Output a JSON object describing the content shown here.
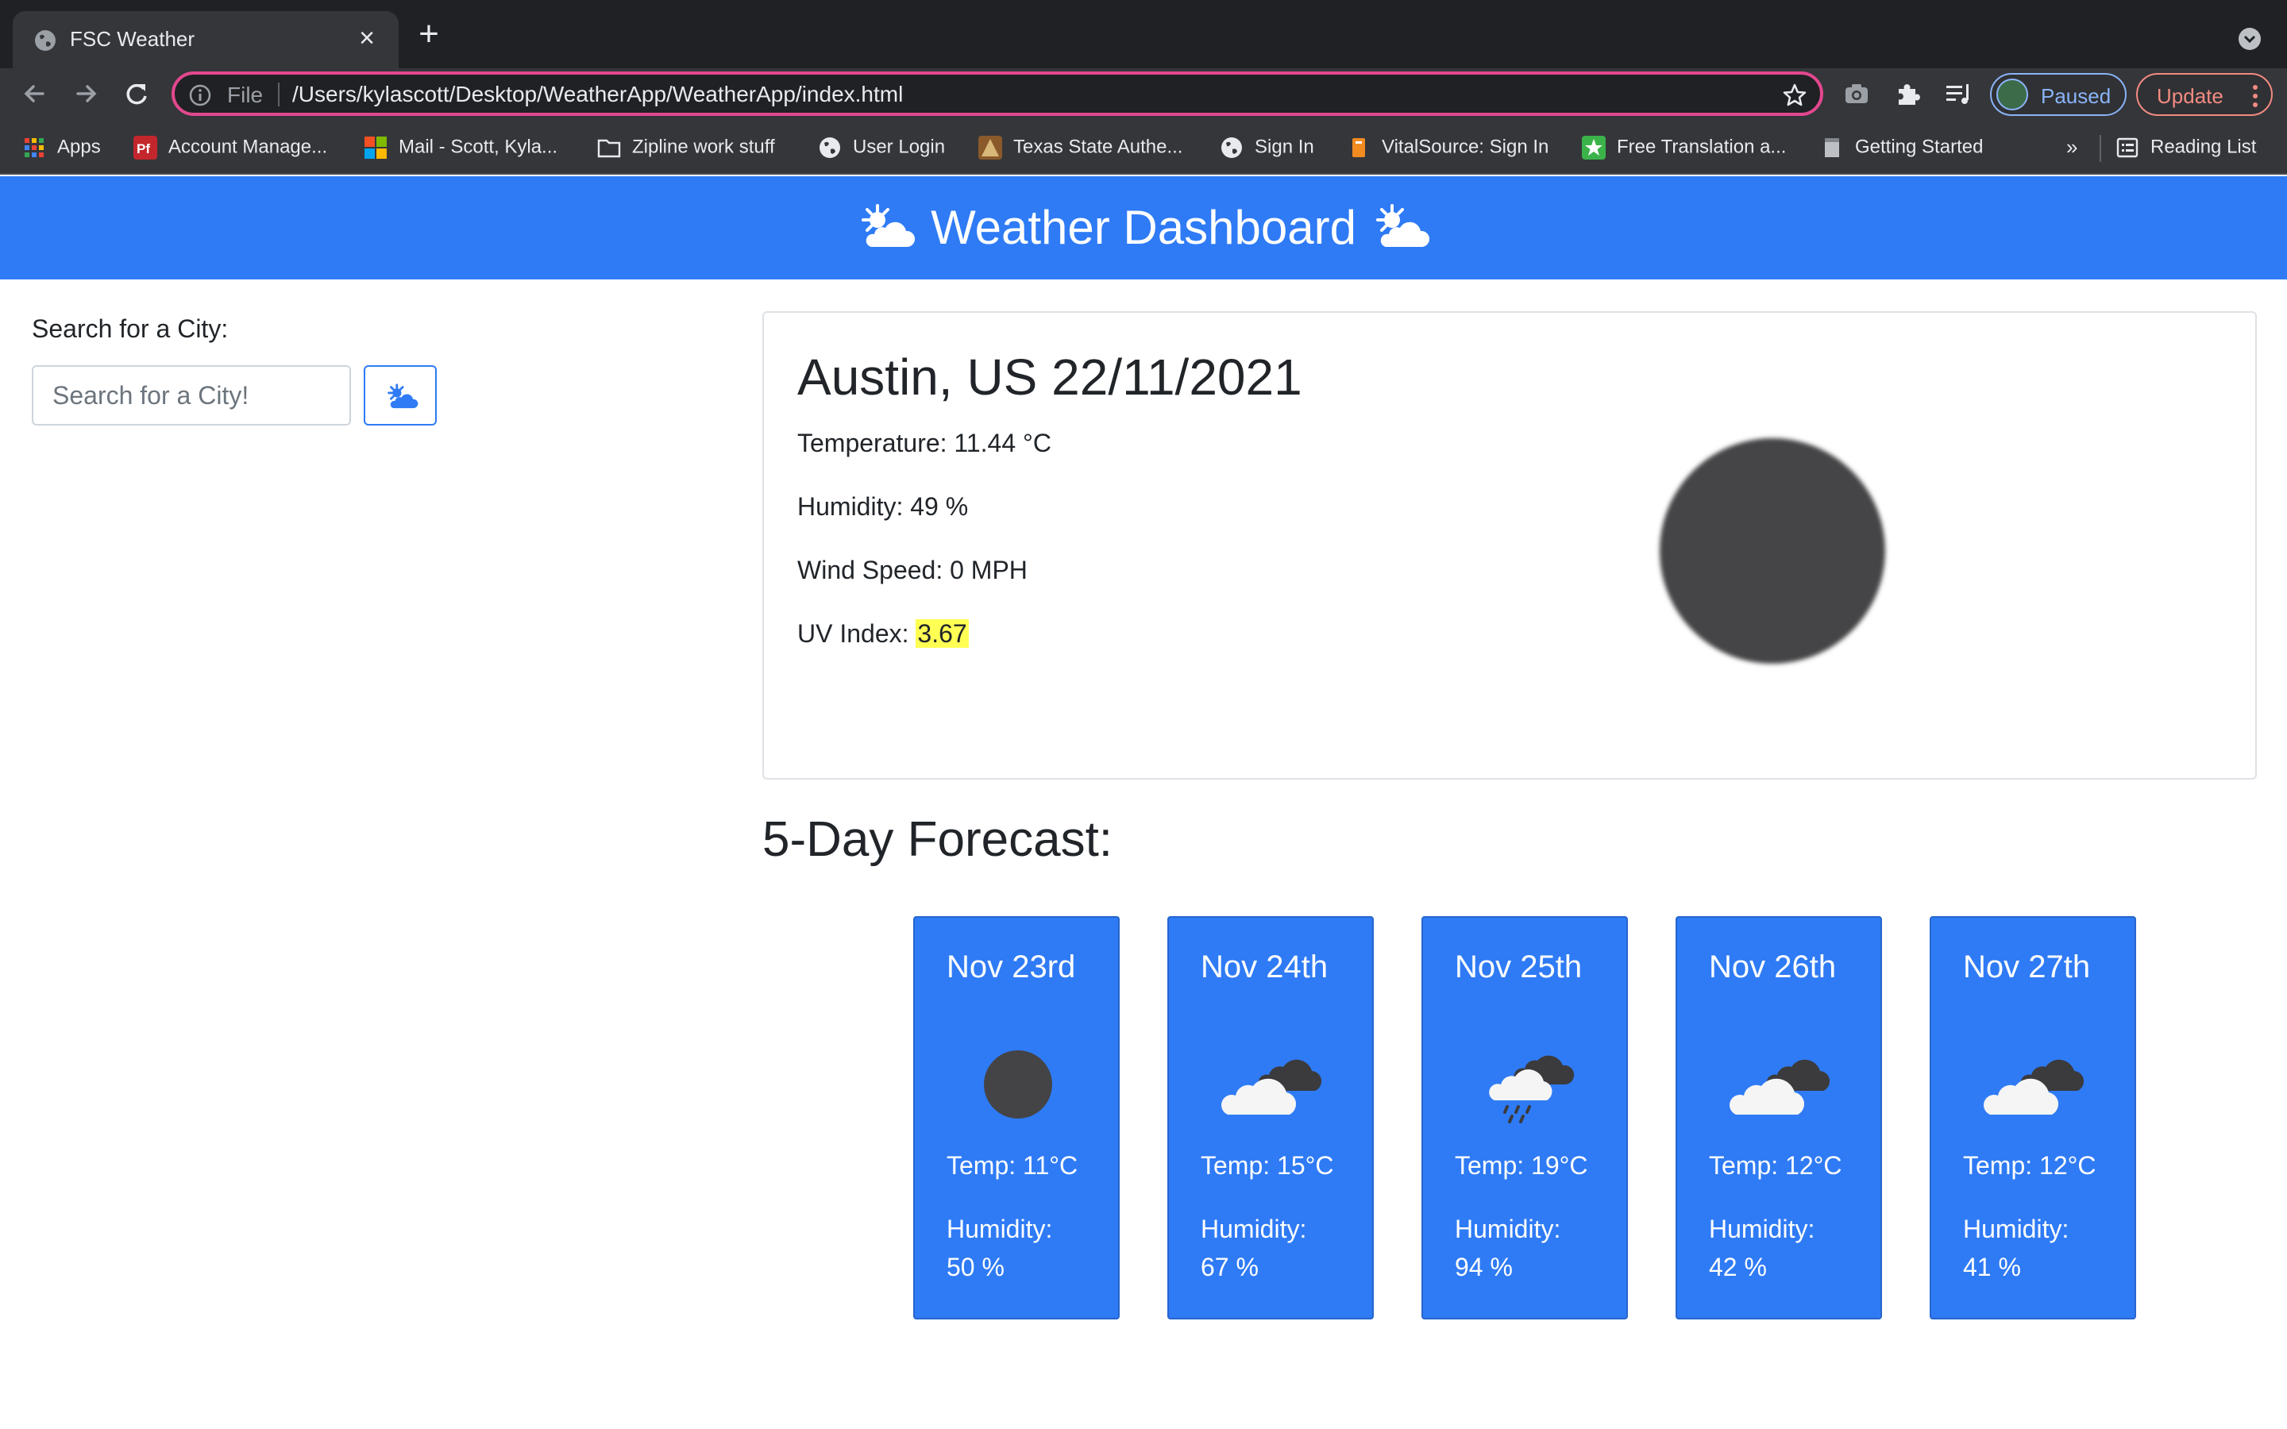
{
  "browser": {
    "tab_title": "FSC Weather",
    "address_scheme": "File",
    "address_url": "/Users/kylascott/Desktop/WeatherApp/WeatherApp/index.html",
    "profile_label": "Paused",
    "update_label": "Update",
    "bookmarks": [
      {
        "label": "Apps",
        "icon": "apps-grid-icon"
      },
      {
        "label": "Account Manage...",
        "icon": "pf-icon"
      },
      {
        "label": "Mail - Scott, Kyla...",
        "icon": "microsoft-icon"
      },
      {
        "label": "Zipline work stuff",
        "icon": "folder-icon"
      },
      {
        "label": "User Login",
        "icon": "globe-icon"
      },
      {
        "label": "Texas State Authe...",
        "icon": "texas-state-icon"
      },
      {
        "label": "Sign In",
        "icon": "globe-icon"
      },
      {
        "label": "VitalSource: Sign In",
        "icon": "vitalsource-icon"
      },
      {
        "label": "Free Translation a...",
        "icon": "translation-icon"
      },
      {
        "label": "Getting Started",
        "icon": "page-icon"
      }
    ],
    "more_bookmarks": "»",
    "reading_list": "Reading List"
  },
  "header": {
    "title": "Weather Dashboard",
    "icon": "sun-behind-cloud-icon",
    "color": "#2f7bf5"
  },
  "search": {
    "label": "Search for a City:",
    "placeholder": "Search for a City!",
    "button_icon": "sun-behind-cloud-icon"
  },
  "current": {
    "heading": "Austin, US 22/11/2021",
    "temperature": "Temperature: 11.44 °C",
    "humidity": "Humidity: 49 %",
    "wind": "Wind Speed: 0 MPH",
    "uv_label": "UV Index: ",
    "uv_value": "3.67",
    "uv_color": "#ffff54",
    "icon": "dark-moon-icon"
  },
  "forecast": {
    "heading": "5-Day Forecast:",
    "days": [
      {
        "date": "Nov 23rd",
        "icon": "dark-moon-icon",
        "temp": "Temp: 11°C",
        "humidity_label": "Humidity:",
        "humidity": "50 %"
      },
      {
        "date": "Nov 24th",
        "icon": "clouds-icon",
        "temp": "Temp: 15°C",
        "humidity_label": "Humidity:",
        "humidity": "67 %"
      },
      {
        "date": "Nov 25th",
        "icon": "rain-cloud-icon",
        "temp": "Temp: 19°C",
        "humidity_label": "Humidity:",
        "humidity": "94 %"
      },
      {
        "date": "Nov 26th",
        "icon": "clouds-icon",
        "temp": "Temp: 12°C",
        "humidity_label": "Humidity:",
        "humidity": "42 %"
      },
      {
        "date": "Nov 27th",
        "icon": "clouds-icon",
        "temp": "Temp: 12°C",
        "humidity_label": "Humidity:",
        "humidity": "41 %"
      }
    ]
  }
}
